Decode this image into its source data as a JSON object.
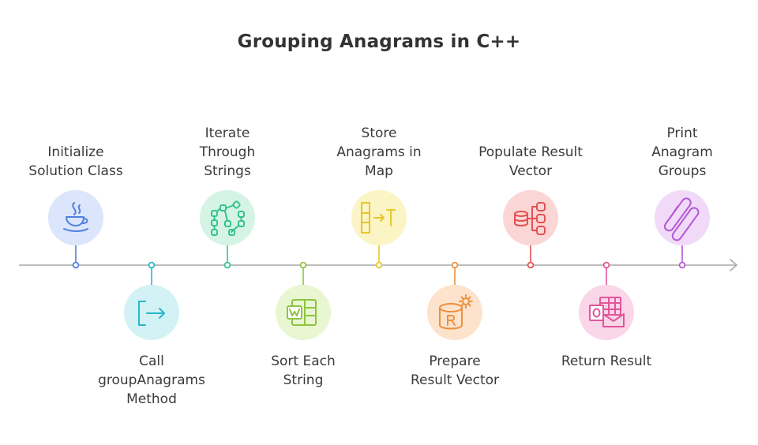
{
  "title": "Grouping Anagrams in C++",
  "steps": [
    {
      "label": [
        "Initialize",
        "Solution Class"
      ],
      "icon": "java-cup-icon",
      "color": "#4f7fe0",
      "bg": "#dbe5fb",
      "side": "top"
    },
    {
      "label": [
        "Call",
        "groupAnagrams",
        "Method"
      ],
      "icon": "sign-in-icon",
      "color": "#27b7c9",
      "bg": "#d3f2f6",
      "side": "bottom"
    },
    {
      "label": [
        "Iterate",
        "Through",
        "Strings"
      ],
      "icon": "path-nodes-icon",
      "color": "#35c38b",
      "bg": "#d6f4e6",
      "side": "top"
    },
    {
      "label": [
        "Sort Each",
        "String"
      ],
      "icon": "word-document-icon",
      "color": "#8fc440",
      "bg": "#e8f6d2",
      "side": "bottom"
    },
    {
      "label": [
        "Store",
        "Anagrams in",
        "Map"
      ],
      "icon": "transform-table-icon",
      "color": "#e6c72a",
      "bg": "#fbf4c4",
      "side": "top"
    },
    {
      "label": [
        "Prepare",
        "Result Vector"
      ],
      "icon": "database-r-icon",
      "color": "#ec8f3c",
      "bg": "#fde3cc",
      "side": "bottom"
    },
    {
      "label": [
        "Populate Result",
        "Vector"
      ],
      "icon": "database-network-icon",
      "color": "#e5504f",
      "bg": "#fbd6d6",
      "side": "top"
    },
    {
      "label": [
        "Return Result"
      ],
      "icon": "outlook-icon",
      "color": "#e0559c",
      "bg": "#fbd5e8",
      "side": "bottom"
    },
    {
      "label": [
        "Print",
        "Anagram",
        "Groups"
      ],
      "icon": "pills-icon",
      "color": "#b457d6",
      "bg": "#f0daf8",
      "side": "top"
    }
  ]
}
